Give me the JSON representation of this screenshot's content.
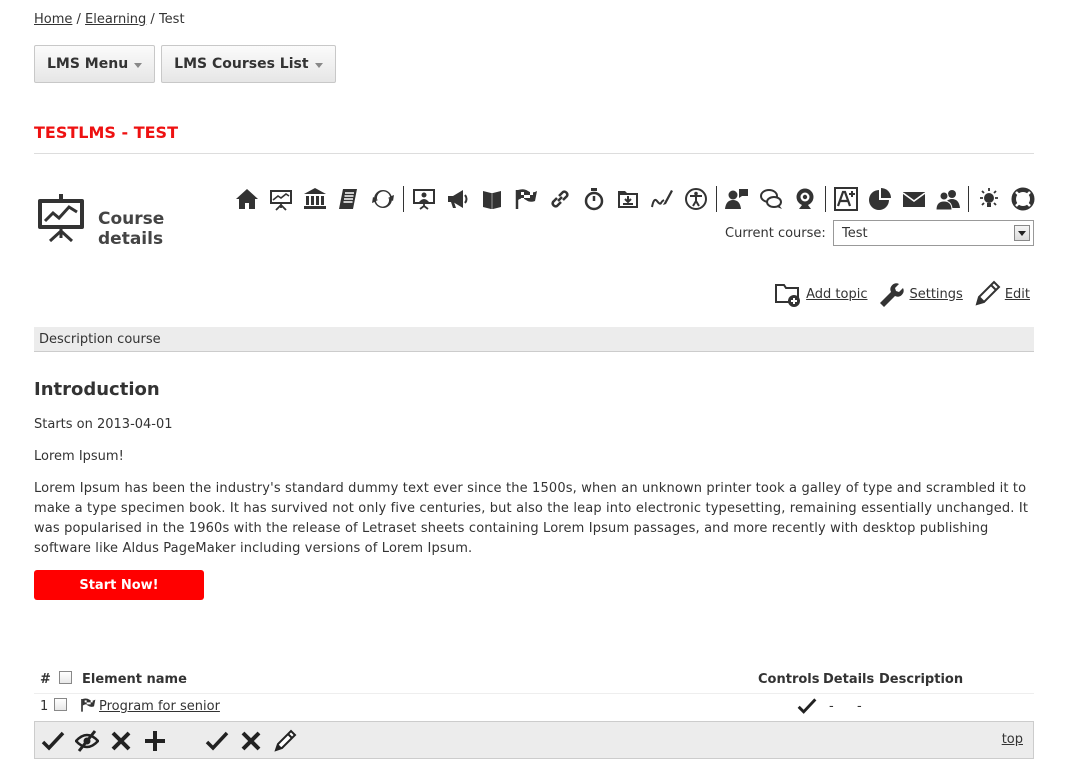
{
  "breadcrumb": {
    "home": "Home",
    "sep1": " / ",
    "elearning": "Elearning",
    "sep2": " / ",
    "current": "Test"
  },
  "menus": {
    "lms_menu": "LMS Menu",
    "lms_courses": "LMS Courses List"
  },
  "page_title": "TESTLMS - TEST",
  "course_details": {
    "heading": "Course details"
  },
  "toolbar_icons": [
    "home-icon",
    "presentation-icon",
    "institution-icon",
    "notes-icon",
    "refresh-icon",
    "presenter-icon",
    "megaphone-icon",
    "books-icon",
    "flag-icon",
    "link-icon",
    "stopwatch-icon",
    "download-folder-icon",
    "signature-icon",
    "accessibility-icon",
    "user-chat-icon",
    "chat-bubbles-icon",
    "webcam-icon",
    "font-size-icon",
    "pie-chart-icon",
    "mail-icon",
    "users-icon",
    "lightbulb-icon",
    "lifebuoy-icon"
  ],
  "current_course": {
    "label": "Current course:",
    "value": "Test"
  },
  "actions": {
    "add_topic": "Add topic",
    "settings": "Settings",
    "edit": "Edit"
  },
  "description_tab": "Description course",
  "intro": {
    "title": "Introduction",
    "starts": "Starts on 2013-04-01",
    "lorem_short": "Lorem Ipsum!",
    "lorem_long": "Lorem Ipsum has been the industry's standard dummy text ever since the 1500s, when an unknown printer took a galley of type and scrambled it to make a type specimen book. It has survived not only five centuries, but also the leap into electronic typesetting, remaining essentially unchanged. It was popularised in the 1960s with the release of Letraset sheets containing Lorem Ipsum passages, and more recently with desktop publishing software like Aldus PageMaker including versions of Lorem Ipsum."
  },
  "start_button": "Start Now!",
  "table": {
    "headers": {
      "num": "#",
      "name": "Element name",
      "controls": "Controls",
      "details": "Details",
      "description": "Description"
    },
    "rows": [
      {
        "num": "1",
        "name": "Program for senior",
        "details": "-",
        "description": "-"
      }
    ]
  },
  "bottom": {
    "top_link": "top"
  }
}
